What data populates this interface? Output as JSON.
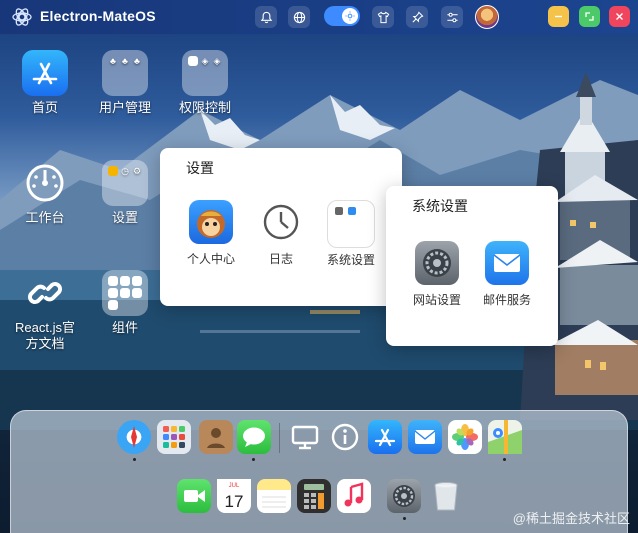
{
  "app": {
    "title": "Electron-MateOS",
    "logo_icon": "electron-logo-icon"
  },
  "topbar": {
    "buttons": [
      {
        "name": "bell-icon"
      },
      {
        "name": "globe-icon"
      },
      {
        "name": "theme-toggle",
        "state": "on"
      },
      {
        "name": "shirt-icon"
      },
      {
        "name": "pin-icon"
      },
      {
        "name": "sliders-icon"
      }
    ],
    "window_controls": [
      {
        "name": "minimize-button",
        "color": "#f5c24a"
      },
      {
        "name": "maximize-button",
        "color": "#4cc968"
      },
      {
        "name": "close-button",
        "color": "#f0455c"
      }
    ]
  },
  "desktop": {
    "icons": [
      {
        "id": "home",
        "label": "首页",
        "icon": "app-store-icon"
      },
      {
        "id": "user-mgmt",
        "label": "用户管理",
        "icon": "folder-icon"
      },
      {
        "id": "perm-ctrl",
        "label": "权限控制",
        "icon": "folder-icon"
      },
      {
        "id": "workbench",
        "label": "工作台",
        "icon": "dashboard-icon"
      },
      {
        "id": "settings",
        "label": "设置",
        "icon": "folder-icon"
      },
      {
        "id": "react-docs",
        "label": "React.js官方文档",
        "label_lines": [
          "React.js官",
          "方文档"
        ],
        "icon": "link-icon"
      },
      {
        "id": "components",
        "label": "组件",
        "icon": "folder-icon"
      }
    ]
  },
  "settings_popup": {
    "title": "设置",
    "items": [
      {
        "label": "个人中心",
        "icon": "monkey-avatar-icon"
      },
      {
        "label": "日志",
        "icon": "clock-icon"
      },
      {
        "label": "系统设置",
        "icon": "folder-icon"
      }
    ]
  },
  "system_popup": {
    "title": "系统设置",
    "items": [
      {
        "label": "网站设置",
        "icon": "gear-icon"
      },
      {
        "label": "邮件服务",
        "icon": "mail-icon"
      }
    ]
  },
  "dock": {
    "row1": [
      "safari-icon",
      "launchpad-icon",
      "contacts-icon",
      "messages-icon",
      "monitor-icon",
      "info-icon",
      "app-store-icon",
      "mail-icon",
      "photos-icon",
      "maps-icon"
    ],
    "row2": [
      "facetime-icon",
      "calendar-icon",
      "notes-icon",
      "calculator-icon",
      "music-icon",
      "settings-icon",
      "trash-icon"
    ],
    "calendar": {
      "month": "JUL",
      "day": "17"
    }
  },
  "watermark": "@稀土掘金技术社区"
}
